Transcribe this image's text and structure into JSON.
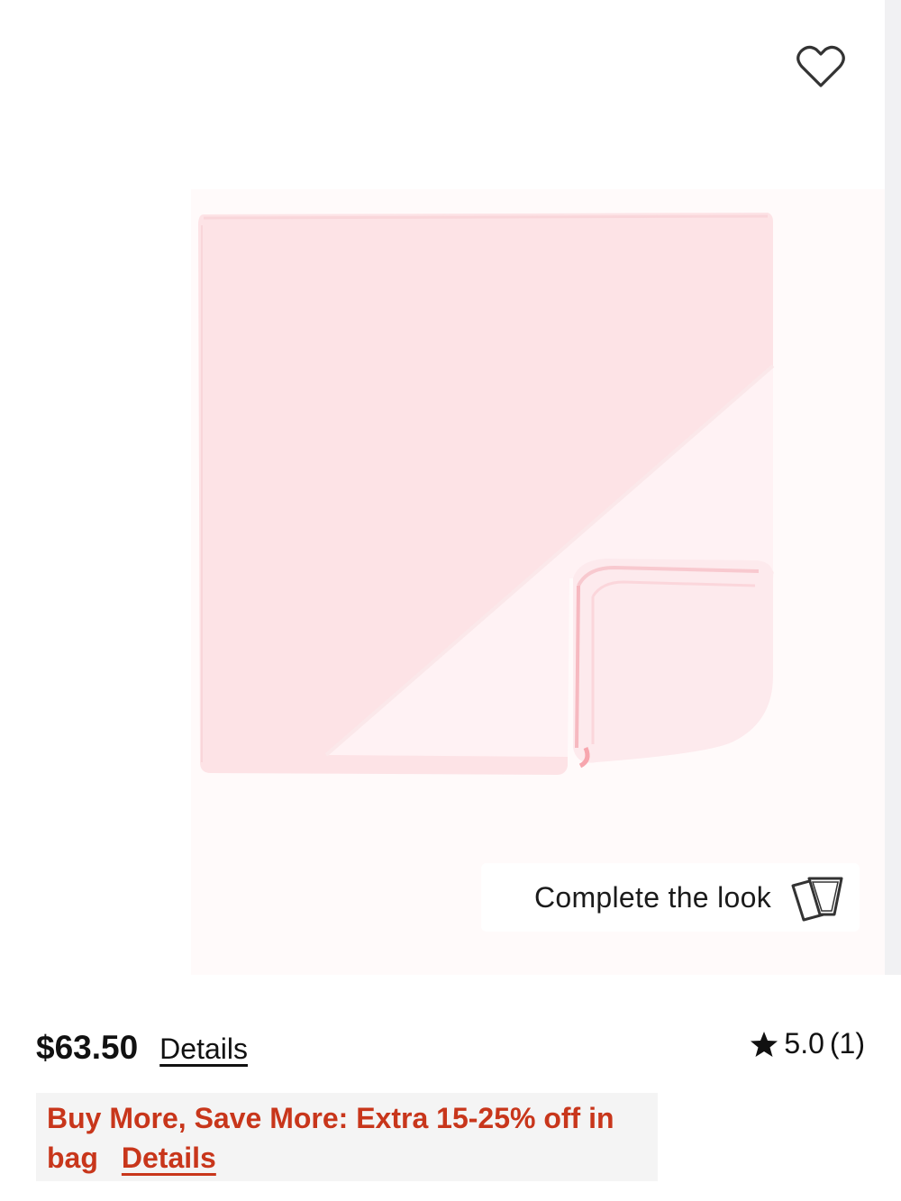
{
  "product": {
    "image_alt": "Pink hooded baby towel",
    "favorite_icon": "heart-outline-icon",
    "complete_the_look_label": "Complete the look",
    "complete_the_look_icon": "cards-icon"
  },
  "pricing": {
    "price": "$63.50",
    "details_label": "Details",
    "rating_icon": "star-icon",
    "rating_value": "5.0",
    "rating_count": "(1)"
  },
  "promo": {
    "text": "Buy More, Save More: Extra 15-25% off in bag",
    "details_label": "Details"
  },
  "colors": {
    "promo_text": "#c8361b",
    "promo_bg": "#f4f4f4",
    "blanket_pink": "#fde3e6"
  }
}
